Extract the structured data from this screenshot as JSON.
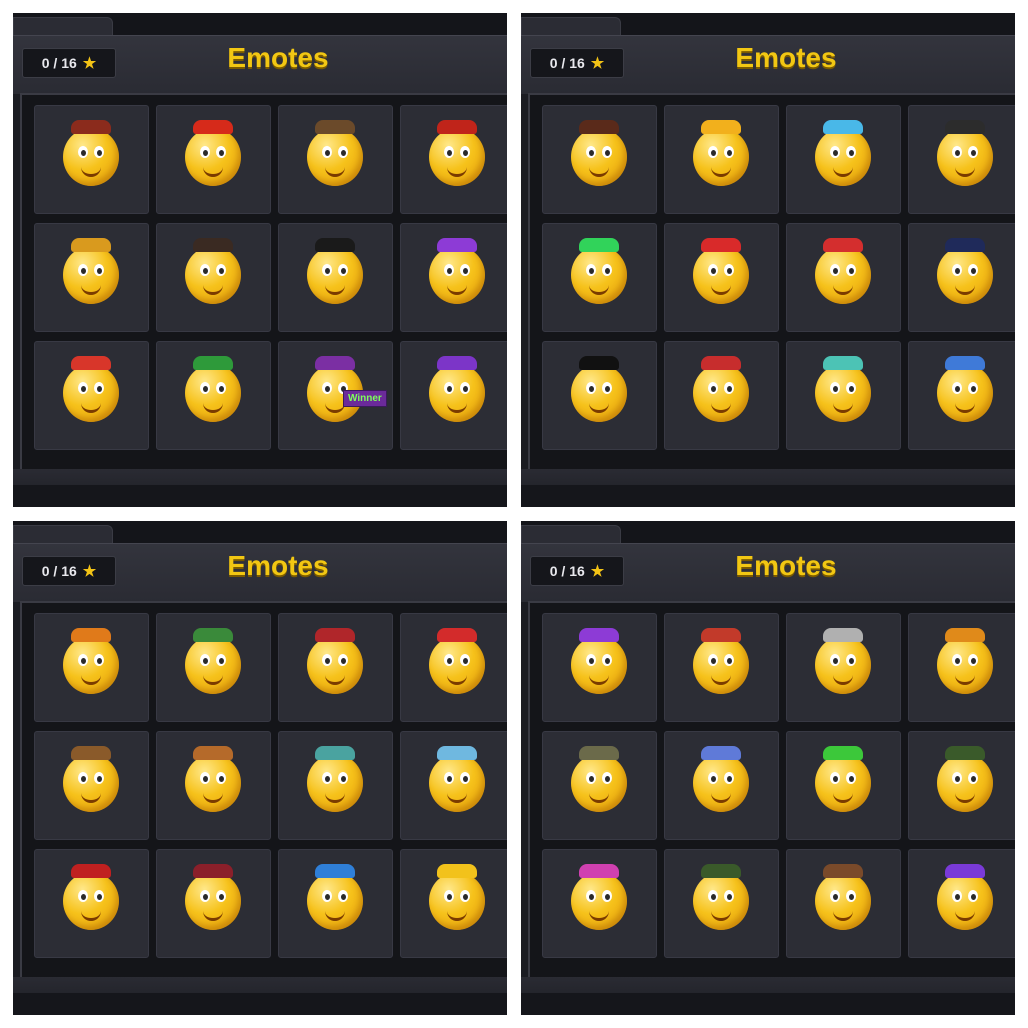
{
  "panels": [
    {
      "counter": "0 / 16",
      "title": "Emotes",
      "emotes": [
        {
          "icon": "emoji-bagpipes-icon",
          "accent": "#8b2b1c"
        },
        {
          "icon": "emoji-boxing-gloves-icon",
          "accent": "#d62a1a"
        },
        {
          "icon": "emoji-detective-magnifier-icon",
          "accent": "#6b4a2a"
        },
        {
          "icon": "emoji-mandarin-tea-icon",
          "accent": "#c0241a"
        },
        {
          "icon": "emoji-saxophone-icon",
          "accent": "#d99a1e"
        },
        {
          "icon": "emoji-fedora-razor-icon",
          "accent": "#3a2a22"
        },
        {
          "icon": "emoji-sunglasses-music-icon",
          "accent": "#1a1a1a"
        },
        {
          "icon": "emoji-genie-laughing-icon",
          "accent": "#8d3bd6"
        },
        {
          "icon": "emoji-kiss-phone-icon",
          "accent": "#d8362a"
        },
        {
          "icon": "emoji-wink-tablet-icon",
          "accent": "#2e9a3a"
        },
        {
          "icon": "emoji-winner-banner-icon",
          "accent": "#7b2fa3"
        },
        {
          "icon": "emoji-headphones-gamer-icon",
          "accent": "#7c35c8"
        }
      ],
      "winner_text": "Winner"
    },
    {
      "counter": "0 / 16",
      "title": "Emotes",
      "emotes": [
        {
          "icon": "emoji-sunglasses-wave-icon",
          "accent": "#5a2a1a"
        },
        {
          "icon": "emoji-shy-cover-icon",
          "accent": "#f2b01c"
        },
        {
          "icon": "emoji-crying-tears-icon",
          "accent": "#49b8e8"
        },
        {
          "icon": "emoji-megaphone-bowler-icon",
          "accent": "#2c2c2c"
        },
        {
          "icon": "emoji-neon-mask-icon",
          "accent": "#31d35a"
        },
        {
          "icon": "emoji-glam-rock-icon",
          "accent": "#d92a2a"
        },
        {
          "icon": "emoji-warrior-helmet-icon",
          "accent": "#d42e2e"
        },
        {
          "icon": "emoji-monocle-clock-icon",
          "accent": "#1f2a5a"
        },
        {
          "icon": "emoji-black-hair-salute-icon",
          "accent": "#111111"
        },
        {
          "icon": "emoji-cowboy-lasso-icon",
          "accent": "#c72d2d"
        },
        {
          "icon": "emoji-viking-dj-icon",
          "accent": "#4cc3b5"
        },
        {
          "icon": "emoji-robot-cowboy-icon",
          "accent": "#3f7ad8"
        }
      ]
    },
    {
      "counter": "0 / 16",
      "title": "Emotes",
      "emotes": [
        {
          "icon": "emoji-eight-ball-whistle-icon",
          "accent": "#e07a1a"
        },
        {
          "icon": "emoji-abacus-icon",
          "accent": "#3a8a3a"
        },
        {
          "icon": "emoji-eight-ball-butler-icon",
          "accent": "#b0262a"
        },
        {
          "icon": "emoji-camera-cap-icon",
          "accent": "#d32b2b"
        },
        {
          "icon": "emoji-wink-suitcase-icon",
          "accent": "#8a5a2a"
        },
        {
          "icon": "emoji-cowboy-coin-icon",
          "accent": "#b56a2a"
        },
        {
          "icon": "emoji-map-reader-icon",
          "accent": "#4aa3a0"
        },
        {
          "icon": "emoji-blue-bat-icon",
          "accent": "#6fb8e0"
        },
        {
          "icon": "emoji-vampire-icon",
          "accent": "#c02020"
        },
        {
          "icon": "emoji-fortune-teller-icon",
          "accent": "#8b1f2a"
        },
        {
          "icon": "emoji-lantern-hood-icon",
          "accent": "#2f7fd8"
        },
        {
          "icon": "emoji-pointing-up-icon",
          "accent": "#f2c21b"
        }
      ]
    },
    {
      "counter": "0 / 16",
      "title": "Emotes",
      "emotes": [
        {
          "icon": "emoji-earmuffs-icon",
          "accent": "#8d3bd6"
        },
        {
          "icon": "emoji-viking-shield-icon",
          "accent": "#c23a2a"
        },
        {
          "icon": "emoji-viking-sword-icon",
          "accent": "#b0b0b0"
        },
        {
          "icon": "emoji-axe-bearded-icon",
          "accent": "#e08a1a"
        },
        {
          "icon": "emoji-soldier-thinking-icon",
          "accent": "#6b6a4a"
        },
        {
          "icon": "emoji-frozen-helmet-icon",
          "accent": "#5f7ad8"
        },
        {
          "icon": "emoji-archer-leaves-icon",
          "accent": "#3cc83a"
        },
        {
          "icon": "emoji-explorer-spyglass-icon",
          "accent": "#3a5a2a"
        },
        {
          "icon": "emoji-tribal-mask-icon",
          "accent": "#d040b0"
        },
        {
          "icon": "emoji-ranger-hat-icon",
          "accent": "#3a5a2a"
        },
        {
          "icon": "emoji-safari-hat-icon",
          "accent": "#7a4a2a"
        },
        {
          "icon": "emoji-purple-hat-map-icon",
          "accent": "#7a3ad8"
        }
      ]
    }
  ]
}
